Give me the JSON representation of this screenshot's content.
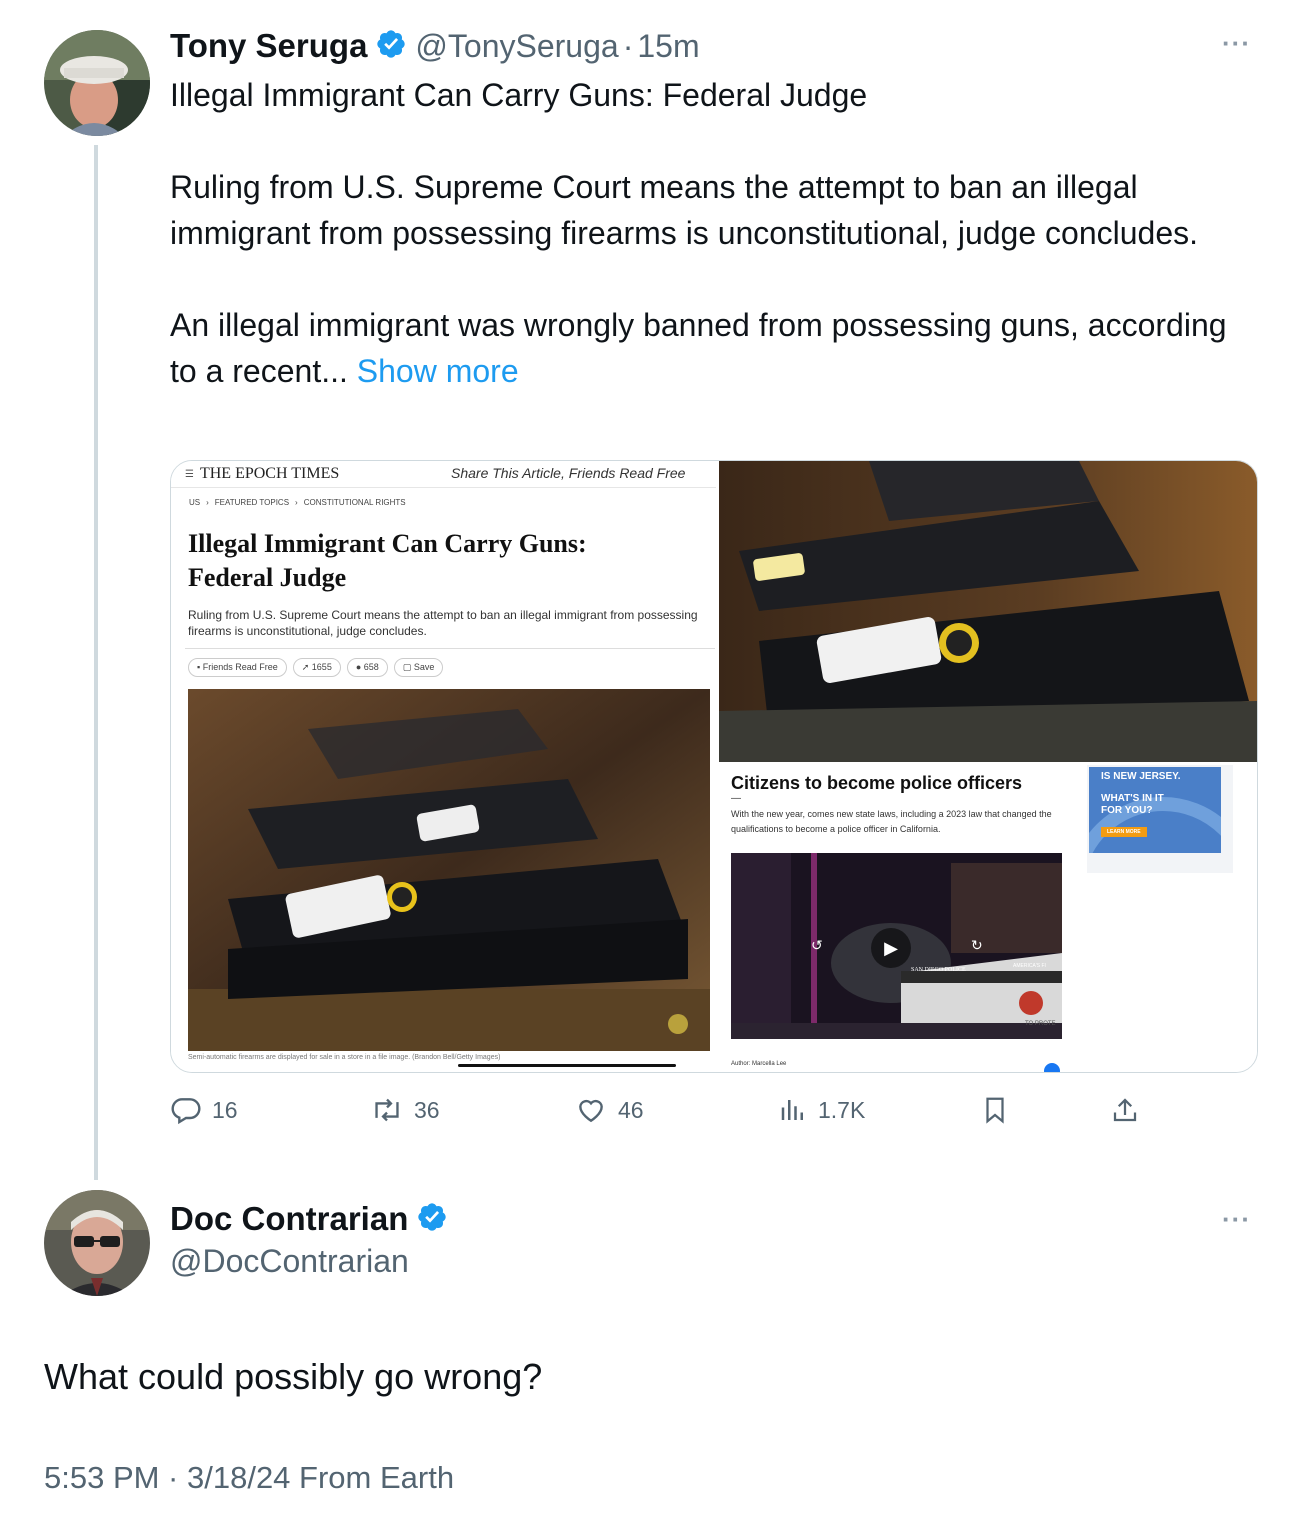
{
  "original_tweet": {
    "display_name": "Tony Seruga",
    "handle": "@TonySeruga",
    "separator": "·",
    "time_ago": "15m",
    "more_label": "···",
    "paragraphs": [
      "Illegal Immigrant Can Carry Guns: Federal Judge",
      "Ruling from U.S. Supreme Court means the attempt to ban an illegal immigrant from possessing firearms is unconstitutional, judge concludes.",
      "An illegal immigrant was wrongly banned from possessing guns, according to a recent... "
    ],
    "show_more": "Show more",
    "article": {
      "masthead": "THE EPOCH TIMES",
      "share_text": "Share This Article, Friends Read Free",
      "breadcrumbs": [
        "US",
        "FEATURED TOPICS",
        "CONSTITUTIONAL RIGHTS"
      ],
      "headline_line1": "Illegal Immigrant Can Carry Guns:",
      "headline_line2": "Federal Judge",
      "subhead": "Ruling from U.S. Supreme Court means the attempt to ban an illegal immigrant from possessing firearms is unconstitutional, judge concludes.",
      "pills": [
        "Friends Read Free",
        "1655",
        "658",
        "Save"
      ],
      "caption": "Semi-automatic firearms are displayed for sale in a store in a file image. (Brandon Bell/Getty Images)"
    },
    "side_article": {
      "headline": "Citizens to become police officers",
      "dash": "—",
      "body": "With the new year, comes new state laws, including a 2023 law that changed the qualifications to become a police officer in California.",
      "video_car_text": "SAN DIEGO POLICE",
      "video_car_text2": "AMERICA'S FI",
      "video_car_text3": "TO PROTE",
      "author": "Author: Marcella Lee",
      "ad_line1": "IS NEW JERSEY.",
      "ad_line2": "WHAT'S IN IT",
      "ad_line3": "FOR YOU?",
      "ad_button": "LEARN MORE"
    },
    "actions": {
      "replies": "16",
      "reposts": "36",
      "likes": "46",
      "views": "1.7K"
    }
  },
  "reply_tweet": {
    "display_name": "Doc Contrarian",
    "handle": "@DocContrarian",
    "more_label": "···",
    "text": "What could possibly go wrong?",
    "timestamp": "5:53 PM · 3/18/24 From Earth"
  },
  "colors": {
    "verified": "#1d9bf0",
    "link": "#1d9bf0",
    "muted": "#536471"
  }
}
